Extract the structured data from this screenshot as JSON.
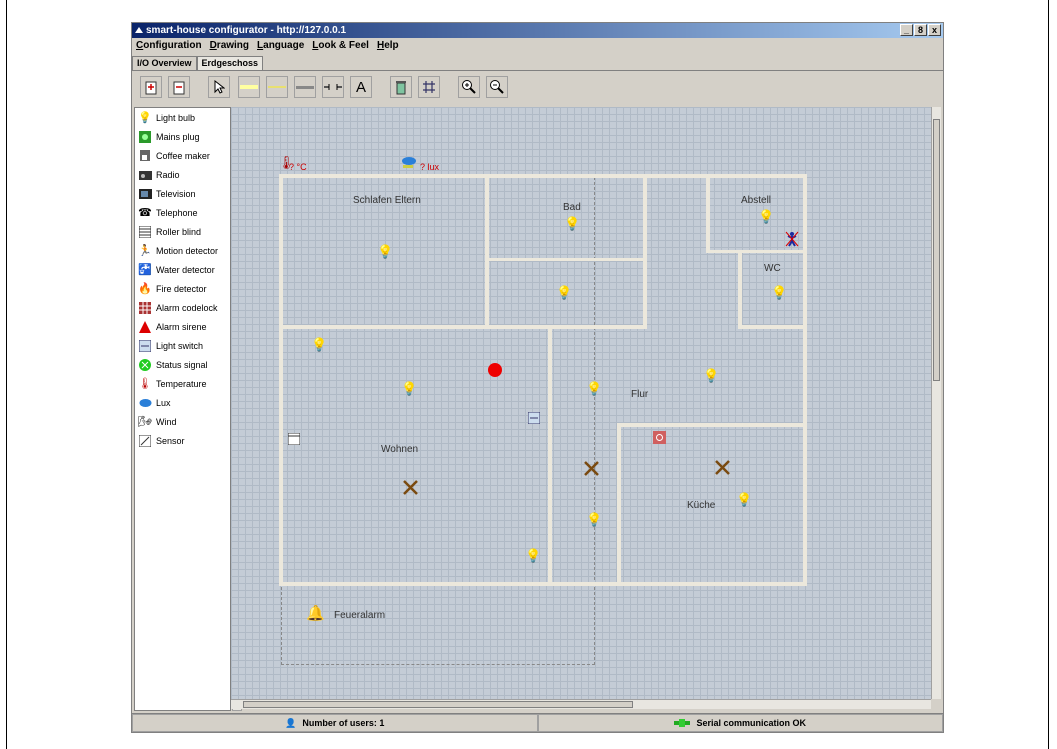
{
  "window": {
    "title": "smart-house configurator - http://127.0.0.1",
    "controls": {
      "minimize": "_",
      "maximize": "8",
      "close": "x"
    }
  },
  "menu": [
    "Configuration",
    "Drawing",
    "Language",
    "Look & Feel",
    "Help"
  ],
  "tabs": [
    {
      "label": "I/O Overview",
      "active": false
    },
    {
      "label": "Erdgeschoss",
      "active": true
    }
  ],
  "toolbar": {
    "buttons": [
      "add-floor-icon",
      "remove-floor-icon",
      "pointer-icon",
      "yellow-line-icon",
      "yellow-line-icon-2",
      "wall-tool-icon",
      "door-tool-icon",
      "text-tool-icon",
      "trash-icon",
      "grid-icon",
      "zoom-in-icon",
      "zoom-out-icon"
    ],
    "text_tool_label": "A"
  },
  "palette": [
    {
      "label": "Light bulb",
      "icon": "light-bulb-icon"
    },
    {
      "label": "Mains plug",
      "icon": "mains-plug-icon"
    },
    {
      "label": "Coffee maker",
      "icon": "coffee-maker-icon"
    },
    {
      "label": "Radio",
      "icon": "radio-icon"
    },
    {
      "label": "Television",
      "icon": "television-icon"
    },
    {
      "label": "Telephone",
      "icon": "telephone-icon"
    },
    {
      "label": "Roller blind",
      "icon": "roller-blind-icon"
    },
    {
      "label": "Motion detector",
      "icon": "motion-detector-icon"
    },
    {
      "label": "Water detector",
      "icon": "water-detector-icon"
    },
    {
      "label": "Fire detector",
      "icon": "fire-detector-icon"
    },
    {
      "label": "Alarm codelock",
      "icon": "alarm-codelock-icon"
    },
    {
      "label": "Alarm sirene",
      "icon": "alarm-sirene-icon"
    },
    {
      "label": "Light switch",
      "icon": "light-switch-icon"
    },
    {
      "label": "Status signal",
      "icon": "status-signal-icon"
    },
    {
      "label": "Temperature",
      "icon": "temperature-icon"
    },
    {
      "label": "Lux",
      "icon": "lux-icon"
    },
    {
      "label": "Wind",
      "icon": "wind-icon"
    },
    {
      "label": "Sensor",
      "icon": "sensor-icon"
    }
  ],
  "canvas": {
    "temperature_label": "? °C",
    "lux_label": "? lux",
    "rooms": [
      "Schlafen Eltern",
      "Bad",
      "Abstell",
      "WC",
      "Flur",
      "Wohnen",
      "Küche"
    ],
    "zone_label": "Feueralarm"
  },
  "status": {
    "users": "Number of users: 1",
    "serial": "Serial communication OK"
  }
}
